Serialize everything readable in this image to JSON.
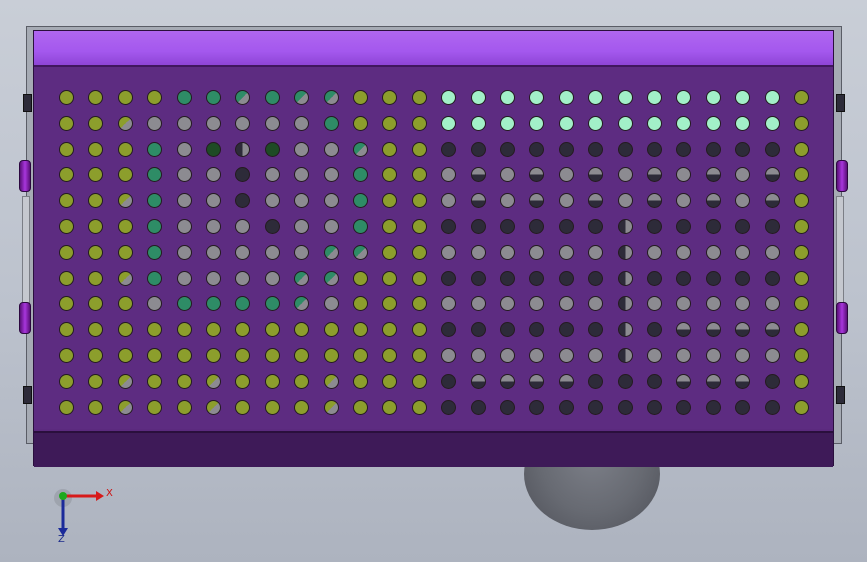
{
  "scene": {
    "view": "top",
    "background": "#c2c7d0"
  },
  "panel": {
    "top_strip_color": "#a458ee",
    "body_color": "#5d2c81",
    "bottom_strip_color": "#3e1a58"
  },
  "hole_grid": {
    "rows": 13,
    "cols": 26,
    "colors": {
      "green": "#8c9e2c",
      "teal": "#2e8c66",
      "dark": "#2d2b39",
      "mint": "#a2f0c8",
      "grey": "#8c8b91",
      "darkgreen": "#1e4b25"
    }
  },
  "triad": {
    "x_label": "X",
    "z_label": "Z",
    "x_color": "#d71a1a",
    "y_color": "#1ea81e",
    "z_color": "#1b2a9a"
  }
}
